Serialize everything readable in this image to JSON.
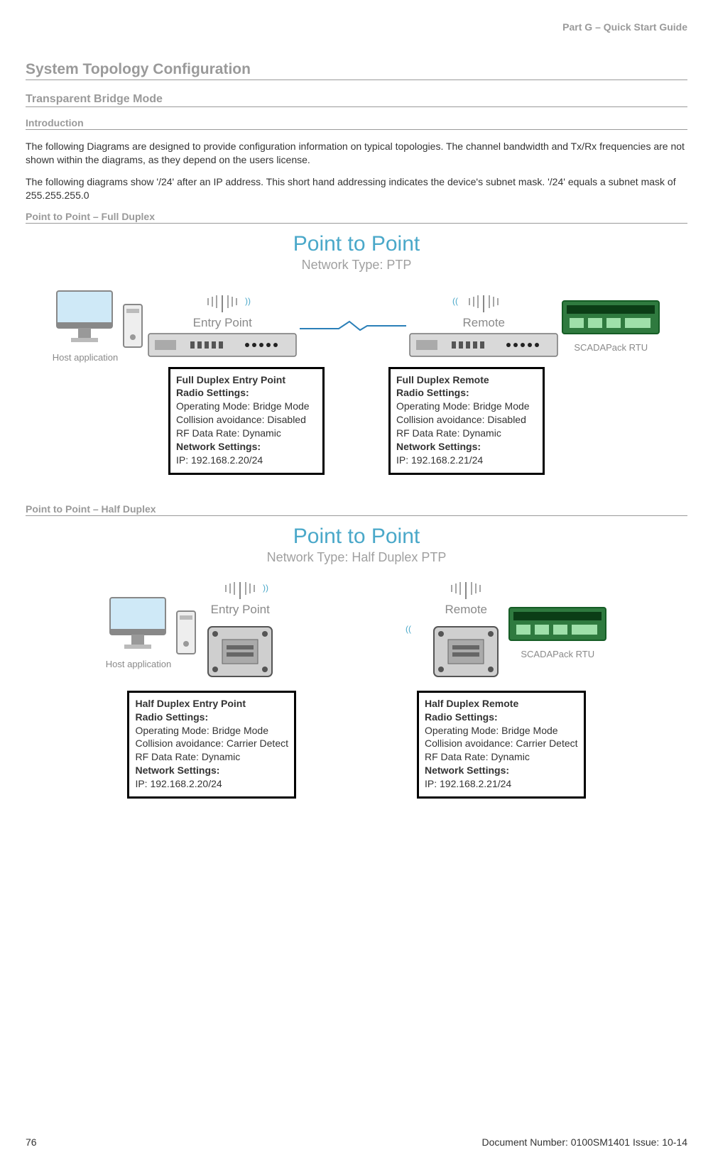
{
  "header": {
    "right": "Part G – Quick Start Guide"
  },
  "h1": "System Topology Configuration",
  "h2": "Transparent Bridge Mode",
  "h3": "Introduction",
  "intro_p1": "The following Diagrams are designed to provide configuration information on typical topologies. The channel bandwidth and Tx/Rx frequencies are not shown within the diagrams, as they depend on the users license.",
  "intro_p2": "The following diagrams show '/24' after an IP address. This short hand addressing indicates the device's subnet mask. '/24' equals a subnet mask of 255.255.255.0",
  "section1_title": "Point to Point – Full Duplex",
  "diagram1": {
    "title": "Point to Point",
    "subtitle": "Network Type: PTP",
    "host_label": "Host application",
    "entry_label": "Entry Point",
    "remote_label": "Remote",
    "rtu_label": "SCADAPack RTU",
    "entry_box": {
      "title": "Full Duplex Entry Point",
      "radio_h": "Radio Settings:",
      "r1": "Operating Mode: Bridge Mode",
      "r2": "Collision avoidance: Disabled",
      "r3": "RF Data Rate: Dynamic",
      "net_h": "Network Settings:",
      "ip": "IP: 192.168.2.20/24"
    },
    "remote_box": {
      "title": "Full Duplex Remote",
      "radio_h": "Radio Settings:",
      "r1": "Operating Mode: Bridge Mode",
      "r2": "Collision avoidance: Disabled",
      "r3": "RF Data Rate: Dynamic",
      "net_h": "Network Settings:",
      "ip": "IP: 192.168.2.21/24"
    }
  },
  "section2_title": "Point to Point – Half Duplex",
  "diagram2": {
    "title": "Point to Point",
    "subtitle": "Network Type: Half Duplex PTP",
    "host_label": "Host application",
    "entry_label": "Entry Point",
    "remote_label": "Remote",
    "rtu_label": "SCADAPack RTU",
    "entry_box": {
      "title": "Half Duplex Entry Point",
      "radio_h": "Radio Settings:",
      "r1": "Operating Mode: Bridge Mode",
      "r2": "Collision avoidance: Carrier Detect",
      "r3": "RF Data Rate: Dynamic",
      "net_h": "Network Settings:",
      "ip": "IP: 192.168.2.20/24"
    },
    "remote_box": {
      "title": "Half Duplex Remote",
      "radio_h": "Radio Settings:",
      "r1": "Operating Mode: Bridge Mode",
      "r2": "Collision avoidance: Carrier Detect",
      "r3": "RF Data Rate: Dynamic",
      "net_h": "Network Settings:",
      "ip": "IP: 192.168.2.21/24"
    }
  },
  "footer": {
    "page": "76",
    "doc": "Document Number: 0100SM1401   Issue: 10-14"
  }
}
